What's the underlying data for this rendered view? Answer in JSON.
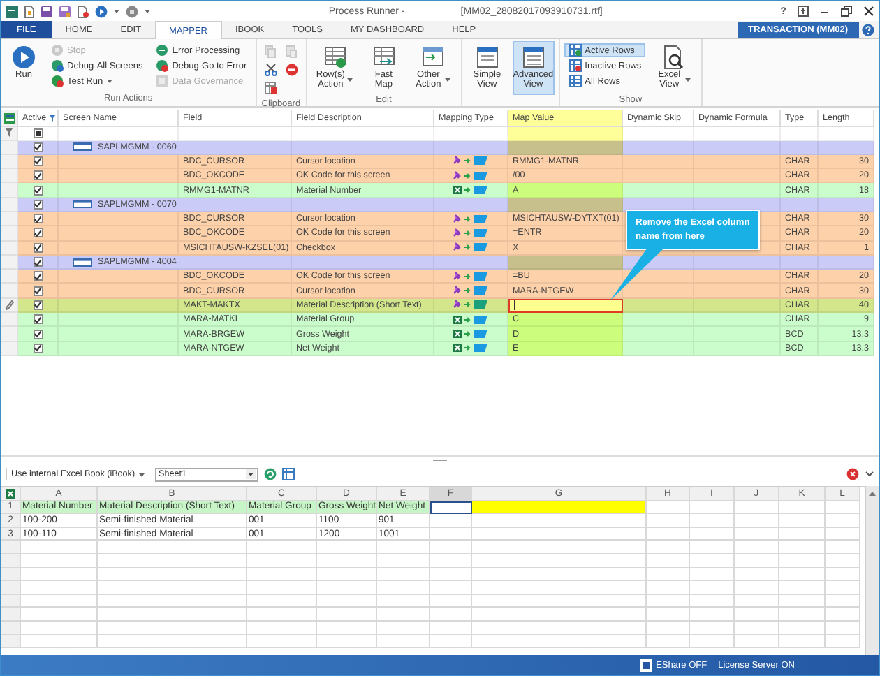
{
  "window": {
    "title": "Process Runner -",
    "file": "[MM02_28082017093910731.rtf]",
    "help": "?"
  },
  "menu_tabs": [
    {
      "label": "FILE",
      "kind": "file",
      "selected": false
    },
    {
      "label": "HOME",
      "kind": "tab",
      "selected": false
    },
    {
      "label": "EDIT",
      "kind": "tab",
      "selected": false
    },
    {
      "label": "MAPPER",
      "kind": "tab",
      "selected": true
    },
    {
      "label": "IBOOK",
      "kind": "tab",
      "selected": false
    },
    {
      "label": "TOOLS",
      "kind": "tab",
      "selected": false
    },
    {
      "label": "MY DASHBOARD",
      "kind": "tab",
      "selected": false
    },
    {
      "label": "HELP",
      "kind": "tab",
      "selected": false
    }
  ],
  "transaction_badge": "TRANSACTION (MM02)",
  "ribbon": [
    {
      "label": "Run Actions",
      "items": [
        {
          "kind": "large",
          "label": "Run",
          "disabled": false,
          "selected": false,
          "dropdown": false
        },
        {
          "kind": "small",
          "label": "Stop",
          "disabled": true,
          "selected": false,
          "dropdown": false
        },
        {
          "kind": "small",
          "label": "Debug-All Screens",
          "disabled": false,
          "selected": false,
          "dropdown": false
        },
        {
          "kind": "small",
          "label": "Test Run",
          "disabled": false,
          "selected": false,
          "dropdown": true
        },
        {
          "kind": "small",
          "label": "Error Processing",
          "disabled": false,
          "selected": false,
          "dropdown": false
        },
        {
          "kind": "small",
          "label": "Debug-Go to Error",
          "disabled": false,
          "selected": false,
          "dropdown": false
        },
        {
          "kind": "small",
          "label": "Data Governance",
          "disabled": true,
          "selected": false,
          "dropdown": false
        }
      ]
    },
    {
      "label": "Clipboard",
      "items": [
        {
          "kind": "icon",
          "disabled": true
        },
        {
          "kind": "icon",
          "disabled": true
        },
        {
          "kind": "icon",
          "disabled": false
        },
        {
          "kind": "icon",
          "disabled": false
        },
        {
          "kind": "icon",
          "disabled": false
        }
      ]
    },
    {
      "label": "Edit",
      "items": [
        {
          "kind": "large",
          "label": "Row(s) Action",
          "disabled": false,
          "selected": false,
          "dropdown": true
        },
        {
          "kind": "large",
          "label": "Fast Map",
          "disabled": false,
          "selected": false,
          "dropdown": false
        },
        {
          "kind": "large",
          "label": "Other Action",
          "disabled": false,
          "selected": false,
          "dropdown": true
        }
      ]
    },
    {
      "items": [
        {
          "kind": "large",
          "label": "Simple View",
          "disabled": false,
          "selected": false,
          "dropdown": false
        },
        {
          "kind": "large",
          "label": "Advanced View",
          "disabled": false,
          "selected": true,
          "dropdown": false
        }
      ]
    },
    {
      "label": "Show",
      "items": [
        {
          "kind": "small",
          "label": "Active Rows",
          "disabled": false,
          "selected": true,
          "dropdown": false
        },
        {
          "kind": "small",
          "label": "Inactive Rows",
          "disabled": false,
          "selected": false,
          "dropdown": false
        },
        {
          "kind": "small",
          "label": "All Rows",
          "disabled": false,
          "selected": false,
          "dropdown": false
        },
        {
          "kind": "large",
          "label": "Excel View",
          "disabled": false,
          "selected": false,
          "dropdown": true
        }
      ]
    }
  ],
  "grid": {
    "columns": [
      "Active",
      "Screen Name",
      "Field",
      "Field Description",
      "Mapping Type",
      "Map Value",
      "Dynamic Skip",
      "Dynamic Formula",
      "Type",
      "Length"
    ],
    "filter_indeterminate": true,
    "rows": [
      {
        "kind": "group",
        "screen": "SAPLMGMM - 0060",
        "active": true,
        "selected": false
      },
      {
        "kind": "fixed",
        "field": "BDC_CURSOR",
        "description": "Cursor location",
        "value": "RMMG1-MATNR",
        "type": "CHAR",
        "length": "30",
        "active": true,
        "selected": false
      },
      {
        "kind": "fixed",
        "field": "BDC_OKCODE",
        "description": "OK Code for this screen",
        "value": "/00",
        "type": "CHAR",
        "length": "20",
        "active": true,
        "selected": false
      },
      {
        "kind": "excel",
        "field": "RMMG1-MATNR",
        "description": "Material Number",
        "value": "A",
        "type": "CHAR",
        "length": "18",
        "active": true,
        "selected": false
      },
      {
        "kind": "group",
        "screen": "SAPLMGMM - 0070",
        "active": true,
        "selected": false
      },
      {
        "kind": "fixed",
        "field": "BDC_CURSOR",
        "description": "Cursor location",
        "value": "MSICHTAUSW-DYTXT(01)",
        "type": "CHAR",
        "length": "30",
        "active": true,
        "selected": false
      },
      {
        "kind": "fixed",
        "field": "BDC_OKCODE",
        "description": "OK Code for this screen",
        "value": "=ENTR",
        "type": "CHAR",
        "length": "20",
        "active": true,
        "selected": false
      },
      {
        "kind": "fixed",
        "field": "MSICHTAUSW-KZSEL(01)",
        "description": "Checkbox",
        "value": "X",
        "type": "CHAR",
        "length": "1",
        "active": true,
        "selected": false
      },
      {
        "kind": "group",
        "screen": "SAPLMGMM - 4004",
        "active": true,
        "selected": false
      },
      {
        "kind": "fixed",
        "field": "BDC_OKCODE",
        "description": "OK Code for this screen",
        "value": "=BU",
        "type": "CHAR",
        "length": "20",
        "active": true,
        "selected": false
      },
      {
        "kind": "fixed",
        "field": "BDC_CURSOR",
        "description": "Cursor location",
        "value": "MARA-NTGEW",
        "type": "CHAR",
        "length": "30",
        "active": true,
        "selected": false
      },
      {
        "kind": "fixed",
        "field": "MAKT-MAKTX",
        "description": "Material Description (Short Text)",
        "type": "CHAR",
        "length": "40",
        "active": true,
        "selected": true
      },
      {
        "kind": "excel",
        "field": "MARA-MATKL",
        "description": "Material Group",
        "value": "C",
        "type": "CHAR",
        "length": "9",
        "active": true,
        "selected": false
      },
      {
        "kind": "excel",
        "field": "MARA-BRGEW",
        "description": "Gross Weight",
        "value": "D",
        "type": "BCD",
        "length": "13.3",
        "active": true,
        "selected": false
      },
      {
        "kind": "excel",
        "field": "MARA-NTGEW",
        "description": "Net Weight",
        "value": "E",
        "type": "BCD",
        "length": "13.3",
        "active": true,
        "selected": false
      }
    ]
  },
  "callout": "Remove the Excel column name from here",
  "excel": {
    "source": "Use internal Excel Book (iBook)",
    "sheet": "Sheet1",
    "columns": [
      {
        "label": "A",
        "selected": false,
        "marked": false
      },
      {
        "label": "B",
        "selected": false,
        "marked": false
      },
      {
        "label": "C",
        "selected": false,
        "marked": false
      },
      {
        "label": "D",
        "selected": false,
        "marked": false
      },
      {
        "label": "E",
        "selected": false,
        "marked": false
      },
      {
        "label": "F",
        "selected": true,
        "marked": false
      },
      {
        "label": "G",
        "selected": false,
        "marked": true
      },
      {
        "label": "H",
        "selected": false,
        "marked": false
      },
      {
        "label": "I",
        "selected": false,
        "marked": false
      },
      {
        "label": "J",
        "selected": false,
        "marked": false
      },
      {
        "label": "K",
        "selected": false,
        "marked": false
      },
      {
        "label": "L",
        "selected": false,
        "marked": false
      }
    ],
    "rows": [
      {
        "number": "1",
        "kind": "header",
        "cells": [
          "Material Number",
          "Material Description (Short Text)",
          "Material Group",
          "Gross Weight",
          "Net Weight"
        ]
      },
      {
        "number": "2",
        "kind": "data",
        "cells": [
          "100-200",
          "Semi-finished Material",
          "001",
          "1100",
          "901"
        ]
      },
      {
        "number": "3",
        "kind": "data",
        "cells": [
          "100-110",
          "Semi-finished Material",
          "001",
          "1200",
          "1001"
        ]
      }
    ]
  },
  "status": {
    "eshare": "EShare OFF",
    "license": "License Server ON"
  }
}
